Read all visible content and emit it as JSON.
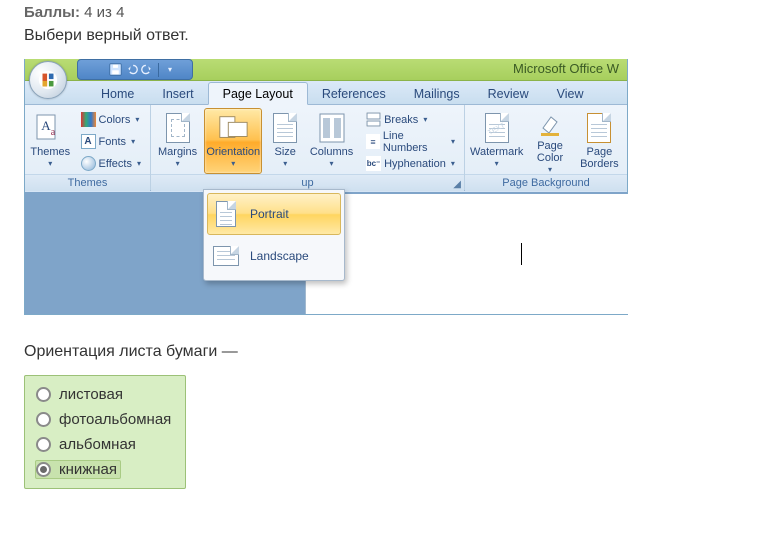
{
  "score": {
    "label": "Баллы:",
    "value": "4 из 4"
  },
  "prompt": "Выбери верный ответ.",
  "word": {
    "app_title": "Microsoft Office W",
    "tabs": {
      "home": "Home",
      "insert": "Insert",
      "page_layout": "Page Layout",
      "references": "References",
      "mailings": "Mailings",
      "review": "Review",
      "view": "View"
    },
    "themes_group": {
      "label": "Themes",
      "themes": "Themes",
      "colors": "Colors",
      "fonts": "Fonts",
      "effects": "Effects"
    },
    "pagesetup_group": {
      "label": "up",
      "margins": "Margins",
      "orientation": "Orientation",
      "size": "Size",
      "columns": "Columns",
      "breaks": "Breaks",
      "line_numbers": "Line Numbers",
      "hyphenation": "Hyphenation"
    },
    "pagebg_group": {
      "label": "Page Background",
      "watermark": "Watermark",
      "page_color": "Page\nColor",
      "page_borders": "Page\nBorders"
    },
    "orientation_menu": {
      "portrait": "Portrait",
      "landscape": "Landscape"
    }
  },
  "question": "Ориентация листа бумаги —",
  "answers": {
    "a1": "листовая",
    "a2": "фотоальбомная",
    "a3": "альбомная",
    "a4": "книжная"
  }
}
